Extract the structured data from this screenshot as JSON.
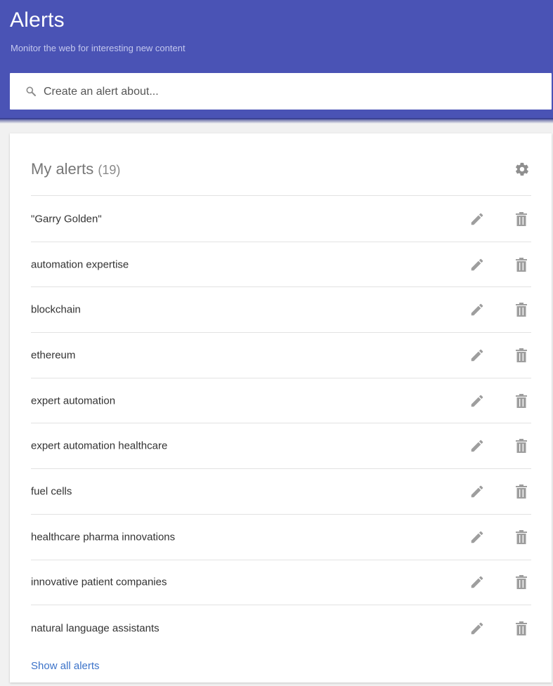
{
  "header": {
    "title": "Alerts",
    "subtitle": "Monitor the web for interesting new content",
    "background": "#4a53b5"
  },
  "search": {
    "placeholder": "Create an alert about...",
    "value": "",
    "icon": "search-icon"
  },
  "my_alerts": {
    "title": "My alerts",
    "count": "(19)",
    "settings_icon": "gear-icon",
    "items": [
      {
        "label": "\"Garry Golden\""
      },
      {
        "label": "automation expertise"
      },
      {
        "label": "blockchain"
      },
      {
        "label": "ethereum"
      },
      {
        "label": "expert automation"
      },
      {
        "label": "expert automation healthcare"
      },
      {
        "label": "fuel cells"
      },
      {
        "label": "healthcare pharma innovations"
      },
      {
        "label": "innovative patient companies"
      },
      {
        "label": "natural language assistants"
      }
    ],
    "item_icons": [
      "pencil-icon",
      "trash-icon"
    ],
    "show_all_label": "Show all alerts"
  },
  "colors": {
    "link": "#3c73c9",
    "icon": "#9e9e9e"
  }
}
